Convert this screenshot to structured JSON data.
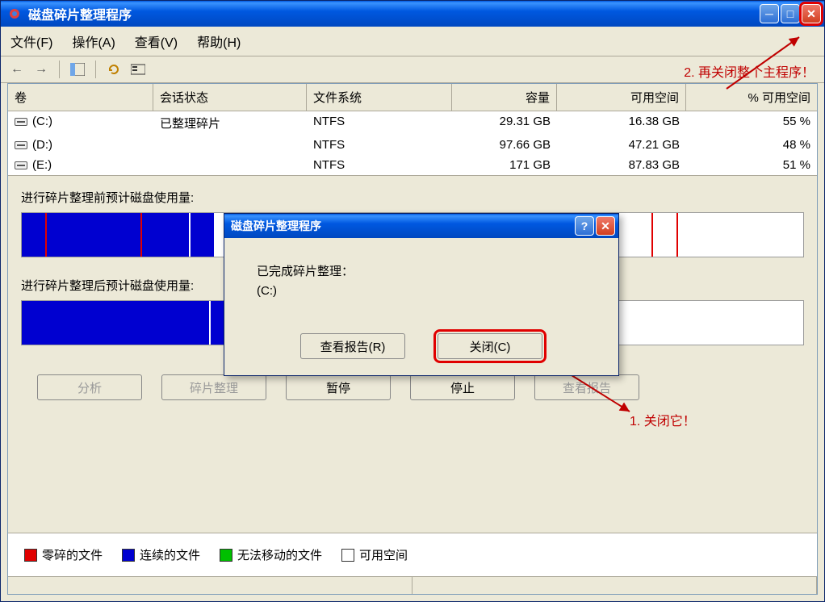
{
  "window": {
    "title": "磁盘碎片整理程序"
  },
  "menu": {
    "file": "文件(F)",
    "action": "操作(A)",
    "view": "查看(V)",
    "help": "帮助(H)"
  },
  "annotations": {
    "a2": "2. 再关闭整个主程序！",
    "a1": "1. 关闭它！"
  },
  "table": {
    "headers": {
      "volume": "卷",
      "status": "会话状态",
      "fs": "文件系统",
      "capacity": "容量",
      "free": "可用空间",
      "pct": "% 可用空间"
    },
    "rows": [
      {
        "vol": "(C:)",
        "status": "已整理碎片",
        "fs": "NTFS",
        "cap": "29.31 GB",
        "free": "16.38 GB",
        "pct": "55 %"
      },
      {
        "vol": "(D:)",
        "status": "",
        "fs": "NTFS",
        "cap": "97.66 GB",
        "free": "47.21 GB",
        "pct": "48 %"
      },
      {
        "vol": "(E:)",
        "status": "",
        "fs": "NTFS",
        "cap": "171 GB",
        "free": "87.83 GB",
        "pct": "51 %"
      }
    ]
  },
  "viz": {
    "before_label": "进行碎片整理前预计磁盘使用量:",
    "after_label": "进行碎片整理后预计磁盘使用量:"
  },
  "buttons": {
    "analyze": "分析",
    "defrag": "碎片整理",
    "pause": "暂停",
    "stop": "停止",
    "report": "查看报告"
  },
  "legend": {
    "frag": "零碎的文件",
    "contig": "连续的文件",
    "unmov": "无法移动的文件",
    "free": "可用空间"
  },
  "dialog": {
    "title": "磁盘碎片整理程序",
    "msg1": "已完成碎片整理：",
    "msg2": "(C:)",
    "view_report": "查看报告(R)",
    "close": "关闭(C)"
  },
  "colors": {
    "frag": "#e00000",
    "contig": "#0000d0",
    "unmov": "#00c000",
    "free": "#ffffff"
  }
}
